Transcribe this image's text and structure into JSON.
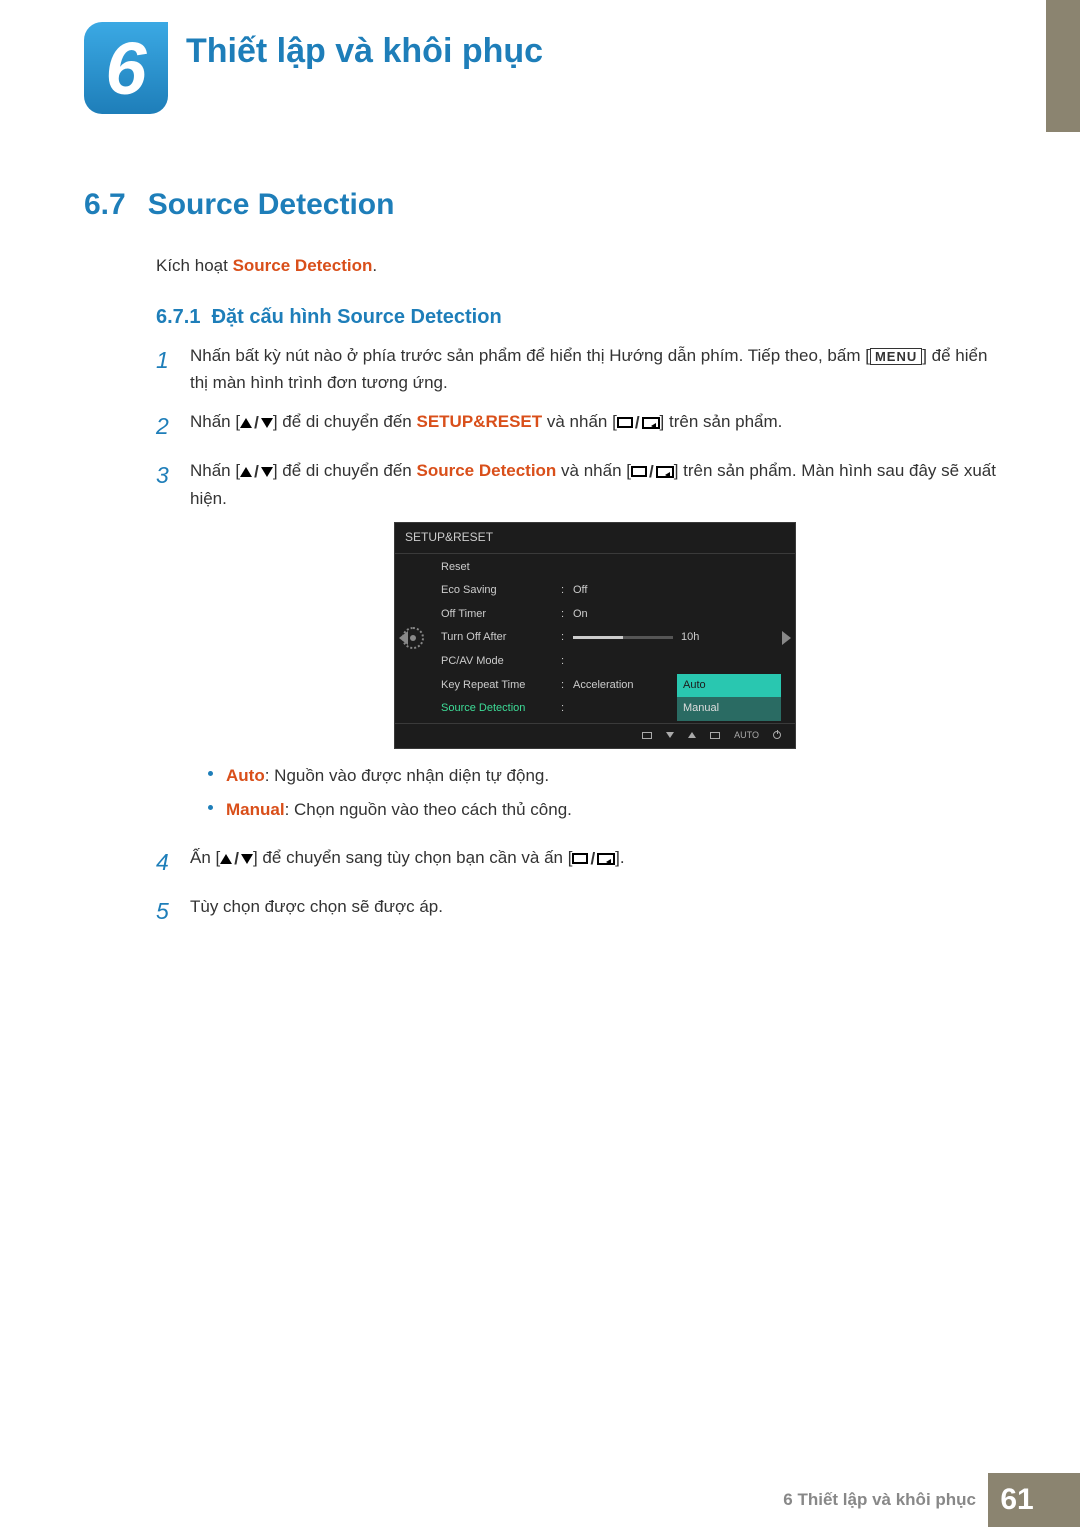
{
  "chapter": {
    "number": "6",
    "title": "Thiết lập và khôi phục"
  },
  "section": {
    "number": "6.7",
    "title": "Source Detection"
  },
  "intro": {
    "prefix": "Kích hoạt ",
    "feature": "Source Detection",
    "suffix": "."
  },
  "subsection": {
    "number": "6.7.1",
    "title": "Đặt cấu hình Source Detection"
  },
  "steps": {
    "s1": {
      "num": "1",
      "t1": "Nhấn bất kỳ nút nào ở phía trước sản phẩm để hiển thị Hướng dẫn phím. Tiếp theo, bấm [",
      "menu": "MENU",
      "t2": "] để hiển thị màn hình trình đơn tương ứng."
    },
    "s2": {
      "num": "2",
      "t1": "Nhấn [",
      "t2": "] để di chuyển đến ",
      "accent": "SETUP&RESET",
      "t3": " và nhấn [",
      "t4": "] trên sản phẩm."
    },
    "s3": {
      "num": "3",
      "t1": "Nhấn [",
      "t2": "] để di chuyển đến ",
      "accent": "Source Detection",
      "t3": " và nhấn [",
      "t4": "] trên sản phẩm. Màn hình sau đây sẽ xuất hiện."
    },
    "s4": {
      "num": "4",
      "t1": "Ấn [",
      "t2": "] để chuyển sang tùy chọn bạn cần và ấn [",
      "t3": "]."
    },
    "s5": {
      "num": "5",
      "text": "Tùy chọn được chọn sẽ được áp."
    }
  },
  "bullets": {
    "b1": {
      "label": "Auto",
      "desc": ": Nguồn vào được nhận diện tự động."
    },
    "b2": {
      "label": "Manual",
      "desc": ": Chọn nguồn vào theo cách thủ công."
    }
  },
  "osd": {
    "title": "SETUP&RESET",
    "rows": [
      {
        "label": "Reset",
        "value": ""
      },
      {
        "label": "Eco Saving",
        "value": "Off"
      },
      {
        "label": "Off Timer",
        "value": "On"
      },
      {
        "label": "Turn Off After",
        "value": "10h",
        "bar": 50
      },
      {
        "label": "PC/AV Mode",
        "value": ""
      },
      {
        "label": "Key Repeat Time",
        "value": "Acceleration"
      },
      {
        "label": "Source Detection",
        "value": "",
        "highlighted": true
      }
    ],
    "dropdown": {
      "active": "Auto",
      "other": "Manual"
    },
    "footer_auto": "AUTO"
  },
  "footer": {
    "label": "6 Thiết lập và khôi phục",
    "page": "61"
  }
}
